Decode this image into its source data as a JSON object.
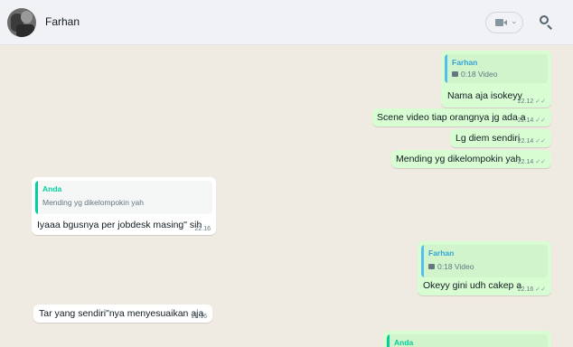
{
  "header": {
    "contact_name": "Farhan"
  },
  "messages": {
    "m1": {
      "quote_author": "Farhan",
      "quote_body": "0:18 Video",
      "text": "Nama aja isokeyy",
      "time": "22.12",
      "ticks": "✓✓"
    },
    "m2": {
      "text": "Scene video tiap orangnya jg ada a",
      "time": "22.14",
      "ticks": "✓✓"
    },
    "m3": {
      "text": "Lg diem sendiri",
      "time": "22.14",
      "ticks": "✓✓"
    },
    "m4": {
      "text": "Mending yg dikelompokin yah",
      "time": "22.14",
      "ticks": "✓✓"
    },
    "m5": {
      "quote_author": "Anda",
      "quote_body": "Mending yg dikelompokin yah",
      "text": "Iyaaa bgusnya per jobdesk masing\" sih",
      "time": "22.16"
    },
    "m6": {
      "quote_author": "Farhan",
      "quote_body": "0:18 Video",
      "text": "Okeyy gini udh cakep a",
      "time": "22.16",
      "ticks": "✓✓"
    },
    "m7": {
      "text": "Tar yang sendiri\"nya menyesuaikan aja",
      "time": "22.16"
    },
    "m8": {
      "quote_author": "Anda"
    }
  },
  "colors": {
    "header_bg": "#f0f2f5",
    "chat_bg": "#efeae2",
    "outgoing_bubble": "#d9fdd3",
    "incoming_bubble": "#ffffff",
    "quote_blue": "#35a4d6",
    "quote_green": "#06cf9c"
  },
  "icons": {
    "header_video": "video-call-icon",
    "header_search": "search-icon"
  }
}
